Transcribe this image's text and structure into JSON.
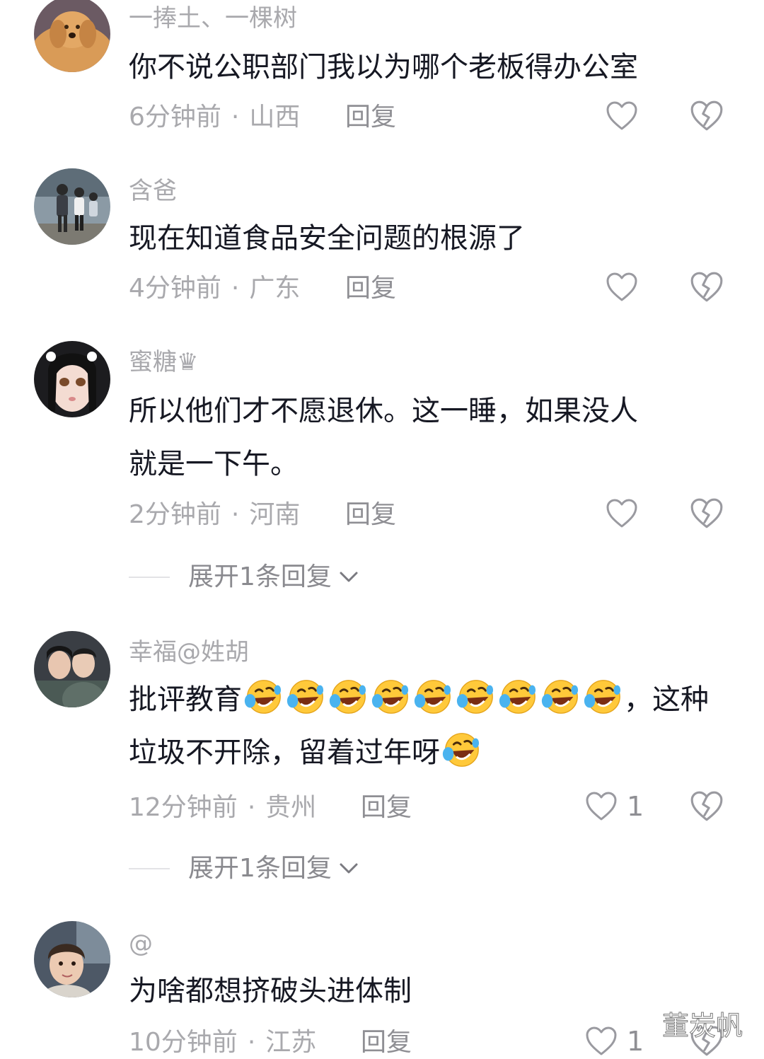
{
  "comments": [
    {
      "username": "一捧土、一棵树",
      "content_lines": [
        "你不说公职部门我以为哪个老板得办公室"
      ],
      "time": "6分钟前",
      "location": "山西",
      "reply_label": "回复",
      "like_count": "",
      "avatar_icon": "avatar-golden-dog"
    },
    {
      "username": "含爸",
      "content_lines": [
        "现在知道食品安全问题的根源了"
      ],
      "time": "4分钟前",
      "location": "广东",
      "reply_label": "回复",
      "like_count": "",
      "avatar_icon": "avatar-family-walking"
    },
    {
      "username": "蜜糖♛",
      "content_lines": [
        "所以他们才不愿退休。这一睡，如果没人",
        "就是一下午。"
      ],
      "time": "2分钟前",
      "location": "河南",
      "reply_label": "回复",
      "like_count": "",
      "avatar_icon": "avatar-anime-girl",
      "expand_label": "展开1条回复"
    },
    {
      "username": "幸福@姓胡",
      "content_lines": [
        "批评教育",
        "，这种",
        "垃圾不开除，留着过年呀"
      ],
      "emoji_icon": "laugh-cry-emoji",
      "time": "12分钟前",
      "location": "贵州",
      "reply_label": "回复",
      "like_count": "1",
      "avatar_icon": "avatar-couple-selfie",
      "expand_label": "展开1条回复"
    },
    {
      "username": "@",
      "content_lines": [
        "为啥都想挤破头进体制"
      ],
      "time": "10分钟前",
      "location": "江苏",
      "reply_label": "回复",
      "like_count": "1",
      "avatar_icon": "avatar-child-portrait"
    }
  ],
  "separator": "·",
  "icons": {
    "like": "heart-outline-icon",
    "dislike": "broken-heart-icon",
    "expand": "chevron-down-icon"
  },
  "watermark": "董炭帆",
  "colors": {
    "username": "#a9a9ad",
    "content": "#161823",
    "meta": "#a9a9ad"
  }
}
